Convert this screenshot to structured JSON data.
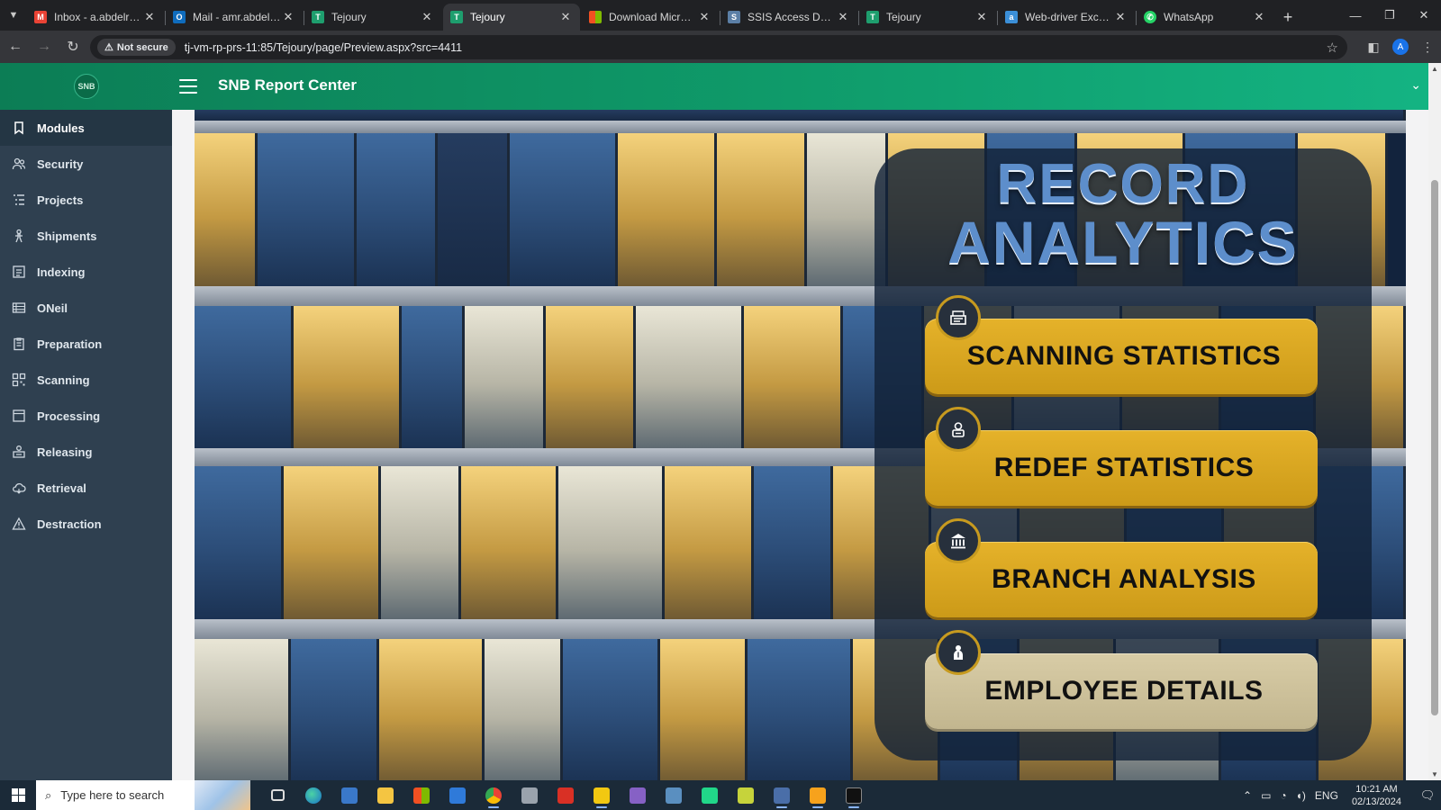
{
  "browser": {
    "tabs": [
      {
        "title": "Inbox - a.abdelrahma",
        "favicon": "gmail-icon",
        "active": false
      },
      {
        "title": "Mail - amr.abdelrahm",
        "favicon": "outlook-icon",
        "active": false
      },
      {
        "title": "Tejoury",
        "favicon": "tejoury-icon",
        "active": false
      },
      {
        "title": "Tejoury",
        "favicon": "tejoury-icon",
        "active": true
      },
      {
        "title": "Download Microsoft",
        "favicon": "microsoft-icon",
        "active": false
      },
      {
        "title": "SSIS Access Denied w",
        "favicon": "ssis-icon",
        "active": false
      },
      {
        "title": "Tejoury",
        "favicon": "tejoury-icon",
        "active": false
      },
      {
        "title": "Web-driver Exception",
        "favicon": "web-driver-icon",
        "active": false
      },
      {
        "title": "WhatsApp",
        "favicon": "whatsapp-icon",
        "active": false
      }
    ],
    "security_chip": "Not secure",
    "url": "tj-vm-rp-prs-11:85/Tejoury/page/Preview.aspx?src=4411",
    "profile_initial": "A"
  },
  "app": {
    "title": "SNB Report Center",
    "logo_text": "SNB"
  },
  "sidebar": {
    "items": [
      {
        "label": "Modules",
        "icon": "bookmark-icon",
        "active": true
      },
      {
        "label": "Security",
        "icon": "users-icon",
        "active": false
      },
      {
        "label": "Projects",
        "icon": "list-icon",
        "active": false
      },
      {
        "label": "Shipments",
        "icon": "shipment-icon",
        "active": false
      },
      {
        "label": "Indexing",
        "icon": "index-icon",
        "active": false
      },
      {
        "label": "ONeil",
        "icon": "table-icon",
        "active": false
      },
      {
        "label": "Preparation",
        "icon": "clipboard-icon",
        "active": false
      },
      {
        "label": "Scanning",
        "icon": "qr-icon",
        "active": false
      },
      {
        "label": "Processing",
        "icon": "folder-icon",
        "active": false
      },
      {
        "label": "Releasing",
        "icon": "release-icon",
        "active": false
      },
      {
        "label": "Retrieval",
        "icon": "cloud-icon",
        "active": false
      },
      {
        "label": "Destraction",
        "icon": "warning-icon",
        "active": false
      }
    ]
  },
  "hero": {
    "title_line1": "RECORD",
    "title_line2": "ANALYTICS",
    "buttons": [
      {
        "label": "SCANNING STATISTICS",
        "icon": "scanner-icon"
      },
      {
        "label": "REDEF STATISTICS",
        "icon": "person-icon"
      },
      {
        "label": "BRANCH ANALYSIS",
        "icon": "bank-icon"
      },
      {
        "label": "EMPLOYEE DETAILS",
        "icon": "employee-icon"
      }
    ]
  },
  "taskbar": {
    "search_placeholder": "Type here to search",
    "language": "ENG",
    "time": "10:21 AM",
    "date": "02/13/2024"
  },
  "colors": {
    "header_green": "#0f9b6a",
    "sidebar_bg": "#2f4050",
    "gold_button": "#d9a520",
    "title_blue": "#5d8ecb"
  }
}
